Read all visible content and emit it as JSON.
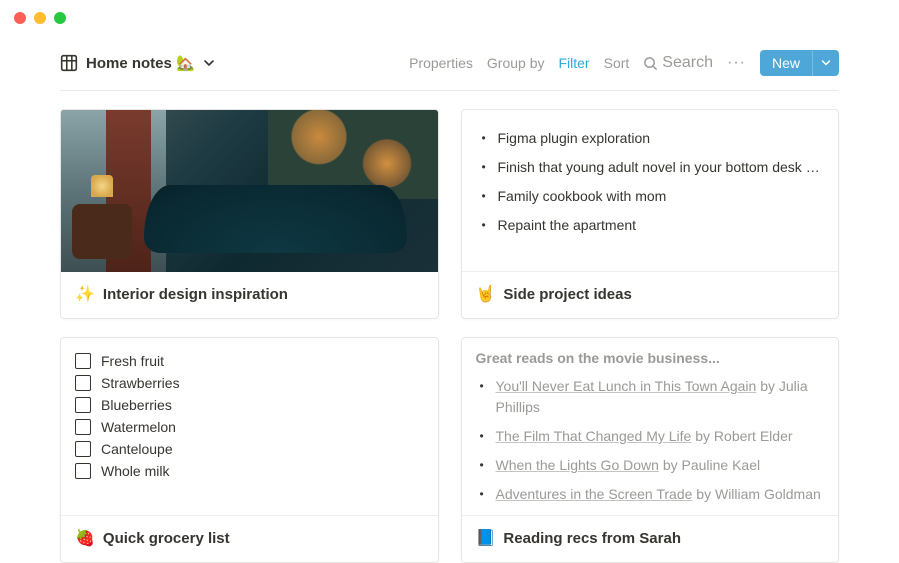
{
  "header": {
    "title": "Home notes",
    "title_emoji": "🏡",
    "toolbar": {
      "properties": "Properties",
      "group_by": "Group by",
      "filter": "Filter",
      "sort": "Sort",
      "search": "Search",
      "new_label": "New"
    }
  },
  "cards": {
    "interior": {
      "emoji": "✨",
      "title": "Interior design inspiration"
    },
    "side_project": {
      "emoji": "🤘",
      "title": "Side project ideas",
      "items": [
        "Figma plugin exploration",
        "Finish that young adult novel in your bottom desk drawer...",
        "Family cookbook with mom",
        "Repaint the apartment"
      ]
    },
    "grocery": {
      "emoji": "🍓",
      "title": "Quick grocery list",
      "items": [
        "Fresh fruit",
        "Strawberries",
        "Blueberries",
        "Watermelon",
        "Canteloupe",
        "Whole milk"
      ]
    },
    "reading": {
      "emoji": "📘",
      "title": "Reading recs from Sarah",
      "heading": "Great reads on the movie business...",
      "items": [
        {
          "book": "You'll Never Eat Lunch in This Town Again",
          "author": "Julia Phillips"
        },
        {
          "book": "The Film That Changed My Life",
          "author": "Robert Elder"
        },
        {
          "book": "When the Lights Go Down",
          "author": "Pauline Kael"
        },
        {
          "book": "Adventures in the Screen Trade",
          "author": "William Goldman"
        }
      ],
      "by_word": "by"
    }
  }
}
